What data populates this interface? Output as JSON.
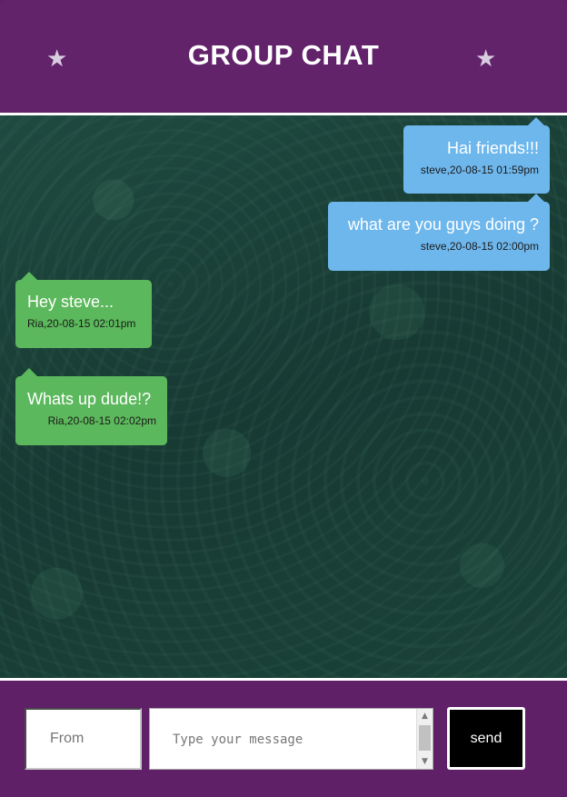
{
  "header": {
    "title": "GROUP CHAT",
    "left_icon": "star-icon",
    "right_icon": "star-icon",
    "background": "#62236b"
  },
  "messages": [
    {
      "text": "Hai friends!!!",
      "meta": "steve,20-08-15 01:59pm",
      "side": "sent"
    },
    {
      "text": "what are you guys doing ?",
      "meta": "steve,20-08-15 02:00pm",
      "side": "sent"
    },
    {
      "text": "Hey steve...",
      "meta": "Ria,20-08-15 02:01pm",
      "side": "received"
    },
    {
      "text": "Whats up dude!?",
      "meta": "Ria,20-08-15 02:02pm",
      "side": "received"
    }
  ],
  "composer": {
    "from_placeholder": "From",
    "message_placeholder": "Type your message",
    "send_label": "send"
  },
  "colors": {
    "sent_bubble": "#6eb7ed",
    "received_bubble": "#5cb85c",
    "footer": "#5f2068",
    "send_button": "#000000"
  }
}
